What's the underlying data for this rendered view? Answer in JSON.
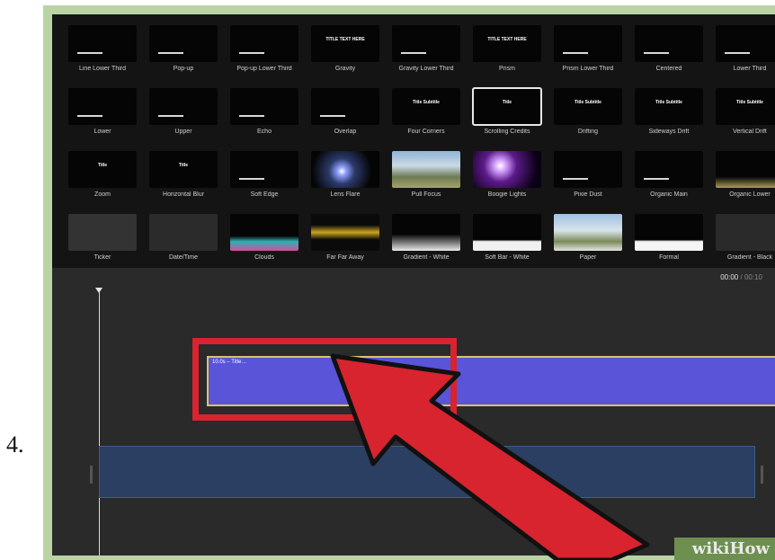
{
  "step_number": "4.",
  "watermark": "wikiHow",
  "timecode": {
    "current": "00:00",
    "separator": "/",
    "total": "00:10"
  },
  "title_clip_label": "10.0s – Title…",
  "tiles": [
    {
      "label": "Line Lower Third",
      "text": ""
    },
    {
      "label": "Pop-up",
      "text": ""
    },
    {
      "label": "Pop-up Lower Third",
      "text": ""
    },
    {
      "label": "Gravity",
      "text": "TITLE TEXT HERE"
    },
    {
      "label": "Gravity Lower Third",
      "text": ""
    },
    {
      "label": "Prism",
      "text": "TITLE TEXT HERE"
    },
    {
      "label": "Prism Lower Third",
      "text": ""
    },
    {
      "label": "Centered",
      "text": ""
    },
    {
      "label": "Lower Third",
      "text": ""
    },
    {
      "label": "Lower",
      "text": ""
    },
    {
      "label": "Upper",
      "text": ""
    },
    {
      "label": "Echo",
      "text": ""
    },
    {
      "label": "Overlap",
      "text": ""
    },
    {
      "label": "Four Corners",
      "text": "Title Subtitle"
    },
    {
      "label": "Scrolling Credits",
      "text": "Title"
    },
    {
      "label": "Drifting",
      "text": "Title Subtitle"
    },
    {
      "label": "Sideways Drift",
      "text": "Title Subtitle"
    },
    {
      "label": "Vertical Drift",
      "text": "Title Subtitle"
    },
    {
      "label": "Zoom",
      "text": "Title"
    },
    {
      "label": "Horizontal Blur",
      "text": "Title"
    },
    {
      "label": "Soft Edge",
      "text": ""
    },
    {
      "label": "Lens Flare",
      "text": ""
    },
    {
      "label": "Pull Focus",
      "text": ""
    },
    {
      "label": "Boogie Lights",
      "text": ""
    },
    {
      "label": "Pixie Dust",
      "text": ""
    },
    {
      "label": "Organic Main",
      "text": ""
    },
    {
      "label": "Organic Lower",
      "text": ""
    },
    {
      "label": "Ticker",
      "text": ""
    },
    {
      "label": "Date/Time",
      "text": ""
    },
    {
      "label": "Clouds",
      "text": ""
    },
    {
      "label": "Far Far Away",
      "text": ""
    },
    {
      "label": "Gradient - White",
      "text": ""
    },
    {
      "label": "Soft Bar - White",
      "text": ""
    },
    {
      "label": "Paper",
      "text": ""
    },
    {
      "label": "Formal",
      "text": ""
    },
    {
      "label": "Gradient - Black",
      "text": ""
    }
  ]
}
